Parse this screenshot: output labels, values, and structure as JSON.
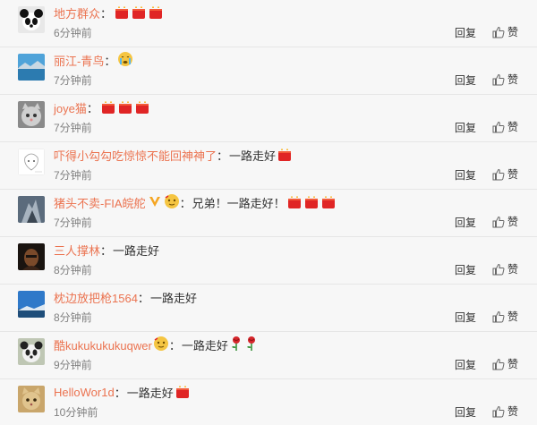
{
  "comments": [
    {
      "user": "地方群众",
      "text": "",
      "time": "6分钟前"
    },
    {
      "user": "丽江-青鸟",
      "text": "",
      "time": "7分钟前"
    },
    {
      "user": "joye猫",
      "text": "",
      "time": "7分钟前"
    },
    {
      "user": "吓得小勾勾吃惊惊不能回神神了",
      "text": "一路走好",
      "time": "7分钟前"
    },
    {
      "user": "猪头不卖-FIA皖舵",
      "text": "兄弟！一路走好！",
      "time": "7分钟前"
    },
    {
      "user": "三人撑林",
      "text": "一路走好",
      "time": "8分钟前"
    },
    {
      "user": "枕边放把枪1564",
      "text": "一路走好",
      "time": "8分钟前"
    },
    {
      "user": "酷kukukukukuqwer",
      "text": "一路走好",
      "time": "9分钟前"
    },
    {
      "user": "HelloWor1d",
      "text": "一路走好",
      "time": "10分钟前"
    }
  ],
  "actions": {
    "reply": "回复",
    "like": "赞"
  },
  "icons": {
    "candle": "candle-emoji-icon",
    "cry": "crying-emoji-icon",
    "rose": "rose-emoji-icon",
    "vip": "vip-badge-icon",
    "like": "thumbs-up-icon"
  },
  "colors": {
    "username": "#eb7350",
    "text": "#333333",
    "time": "#808080",
    "divider": "#e6e6e6",
    "background": "#f7f7f7"
  }
}
